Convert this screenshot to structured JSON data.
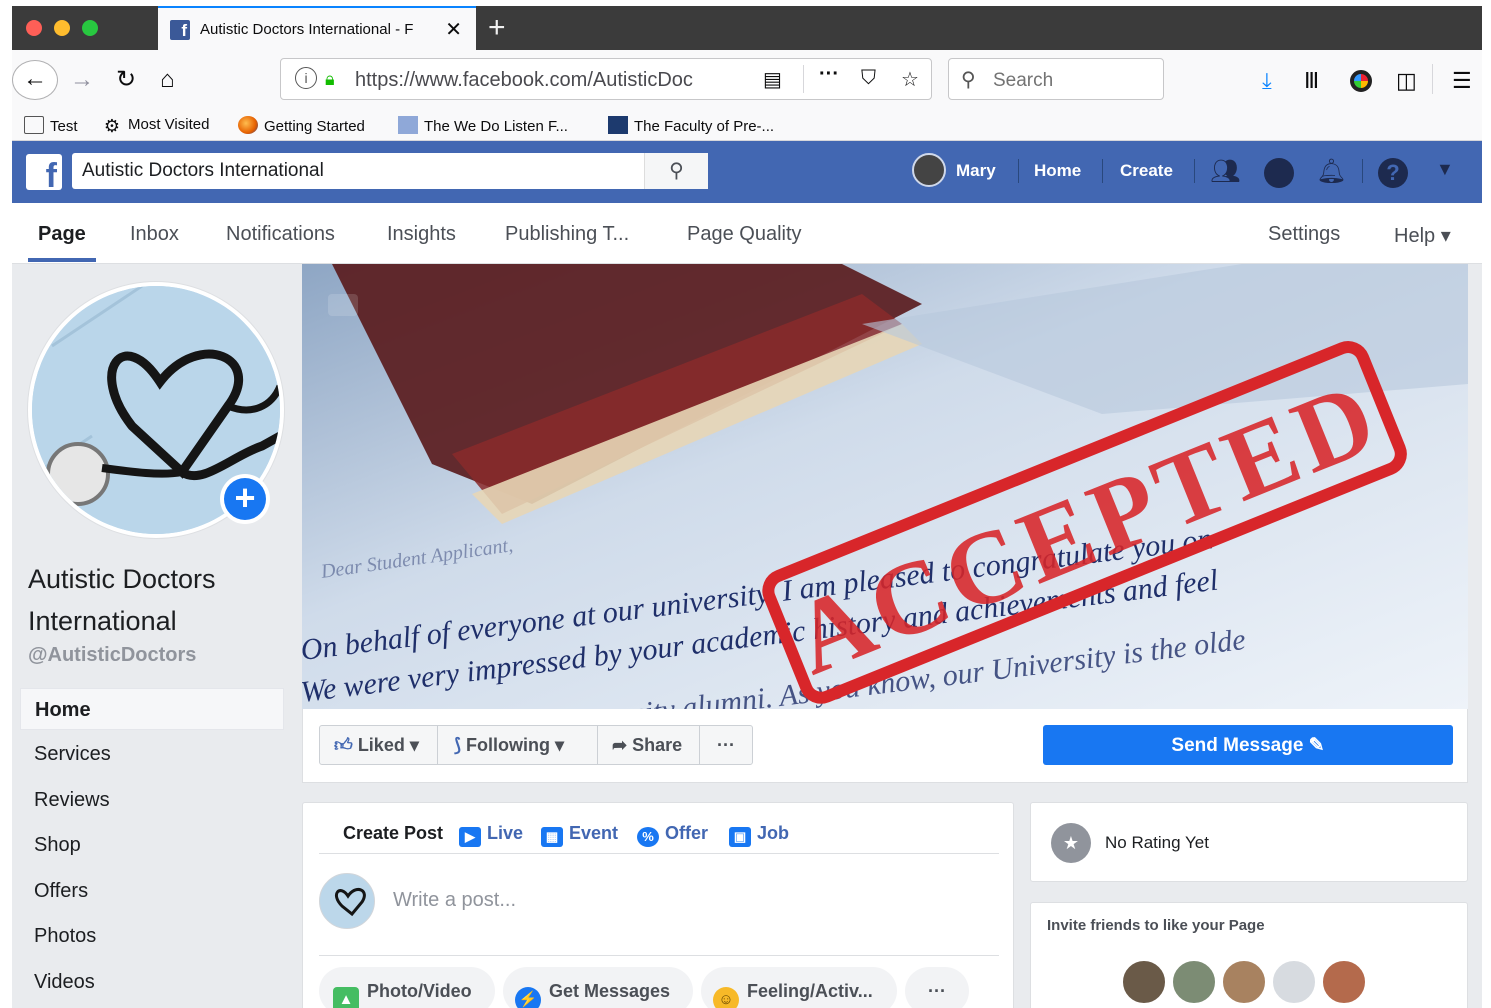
{
  "browser": {
    "tab_title": "Autistic Doctors International - F",
    "tab_favicon": "f",
    "new_tab": "+",
    "close": "✕",
    "url": "https://www.facebook.com/AutisticDoc",
    "search_placeholder": "Search",
    "bookmarks": [
      {
        "label": "Test",
        "icon": "folder-icon"
      },
      {
        "label": "Most Visited",
        "icon": "gear-icon"
      },
      {
        "label": "Getting Started",
        "icon": "firefox-icon"
      },
      {
        "label": "The We Do Listen F...",
        "icon": "site-icon"
      },
      {
        "label": "The Faculty of Pre-...",
        "icon": "site-icon"
      }
    ]
  },
  "facebook": {
    "search_value": "Autistic Doctors International",
    "user_name": "Mary",
    "nav_home": "Home",
    "nav_create": "Create"
  },
  "page_tabs": [
    "Page",
    "Inbox",
    "Notifications",
    "Insights",
    "Publishing T...",
    "Page Quality",
    "Settings",
    "Help ▾"
  ],
  "page": {
    "name": "Autistic Doctors International",
    "handle": "@AutisticDoctors",
    "sidebar": [
      "Home",
      "Services",
      "Reviews",
      "Shop",
      "Offers",
      "Photos",
      "Videos"
    ]
  },
  "cover": {
    "stamp": "ACCEPTED",
    "letter_lines": [
      "Dear Student Applicant,",
      "On behalf of everyone at our university, I am pleased to congratulate you on",
      "We were very impressed by your academic history and achievements and feel",
      "University alumni. As you know, our University is the olde"
    ]
  },
  "actions": {
    "liked": "Liked",
    "following": "Following",
    "share": "Share",
    "more": "···",
    "send_message": "Send Message ✎"
  },
  "composer": {
    "create_post": "Create Post",
    "live": "Live",
    "event": "Event",
    "offer": "Offer",
    "job": "Job",
    "placeholder": "Write a post...",
    "photo_video": "Photo/Video",
    "get_messages": "Get Messages",
    "feeling": "Feeling/Activ...",
    "more": "···"
  },
  "rating": {
    "label": "No Rating Yet"
  },
  "invite": {
    "title": "Invite friends to like your Page"
  },
  "colors": {
    "facebook_blue": "#4267b2",
    "button_blue": "#1877f2",
    "stamp_red": "#d8262a"
  }
}
